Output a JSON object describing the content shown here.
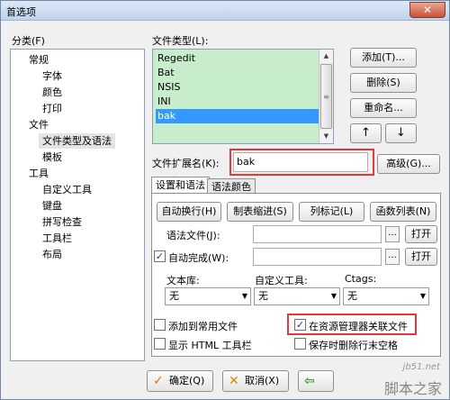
{
  "window": {
    "title": "首选项",
    "close_label": "✕"
  },
  "left": {
    "label": "分类(F)",
    "tree": [
      "常规",
      "字体",
      "颜色",
      "打印",
      "文件",
      "文件类型及语法",
      "模板",
      "工具",
      "自定义工具",
      "键盘",
      "拼写检查",
      "工具栏",
      "布局"
    ]
  },
  "filetypes": {
    "label": "文件类型(L):",
    "items": [
      "Regedit",
      "Bat",
      "NSIS",
      "INI",
      "bak"
    ],
    "selected": "bak",
    "scroll_thumb_glyph": "≡"
  },
  "buttons": {
    "add": "添加(T)...",
    "delete": "删除(S)",
    "rename": "重命名...",
    "up": "↑",
    "down": "↓",
    "advanced": "高级(G)..."
  },
  "extension": {
    "label": "文件扩展名(K):",
    "value": "bak"
  },
  "tabs": [
    "设置和语法",
    "语法颜色"
  ],
  "tabpanel": {
    "row_buttons": [
      "自动换行(H)",
      "制表缩进(S)",
      "列标记(L)",
      "函数列表(N)"
    ],
    "syntax_label": "语法文件(J):",
    "autocomplete_label": "自动完成(W):",
    "autocomplete_checked": true,
    "ellipsis": "...",
    "open": "打开",
    "col_labels": [
      "文本库:",
      "自定义工具:",
      "Ctags:"
    ],
    "combo_values": [
      "无",
      "无",
      "无"
    ],
    "combo_arrow": "▼",
    "checks": [
      {
        "label": "添加到常用文件",
        "checked": false
      },
      {
        "label": "在资源管理器关联文件",
        "checked": true
      },
      {
        "label": "显示 HTML 工具栏",
        "checked": false
      },
      {
        "label": "保存时删除行末空格",
        "checked": false
      }
    ],
    "checkmark": "✓"
  },
  "footer": {
    "ok": "确定(Q)",
    "ok_icon": "✓",
    "cancel": "取消(X)",
    "cancel_icon": "✕",
    "apply_icon": "⇦",
    "watermark_top": "jb51.net",
    "watermark_bottom": "脚本之家"
  },
  "colors": {
    "list_bg": "#c7edcc",
    "selection": "#3399ff",
    "highlight_red": "#e03a3a",
    "ok_icon": "#e07010",
    "cancel_icon": "#d08a00",
    "apply_icon": "#2e9e2e"
  }
}
